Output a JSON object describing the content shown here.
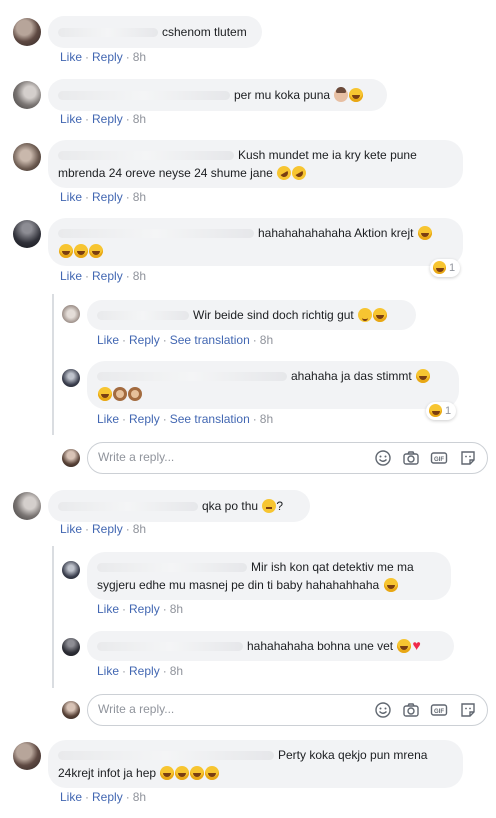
{
  "labels": {
    "like": "Like",
    "reply": "Reply",
    "see_translation": "See translation",
    "dot": "·"
  },
  "reply_placeholder": "Write a reply...",
  "comments": [
    {
      "text": "cshenom tlutem",
      "time": "8h"
    },
    {
      "text": "per mu koka puna",
      "time": "8h"
    },
    {
      "text_line1": "Kush mundet me ia kry kete pune",
      "text_line2": "mbrenda 24 oreve neyse 24 shume jane",
      "time": "8h"
    },
    {
      "text_line1": "hahahahahahaha Aktion krejt",
      "time": "8h",
      "reaction_count": "1"
    },
    {
      "text": "Wir beide sind doch richtig gut",
      "time": "8h"
    },
    {
      "text_line1": "ahahaha ja das stimmt",
      "time": "8h",
      "reaction_count": "1"
    },
    {
      "text": "qka po thu",
      "tail": "?",
      "time": "8h"
    },
    {
      "text_line1": "Mir ish kon qat detektiv me ma",
      "text_line2": "sygjeru edhe mu masnej pe din ti baby hahahahhaha",
      "time": "8h"
    },
    {
      "text": "hahahahaha bohna une vet",
      "time": "8h"
    },
    {
      "text_line1": "Perty koka qekjo pun mrena",
      "text_line2": "24krejt infot ja hep",
      "time": "8h"
    }
  ],
  "reply_tools": [
    "emoji-icon",
    "camera-icon",
    "gif-icon",
    "sticker-icon"
  ]
}
